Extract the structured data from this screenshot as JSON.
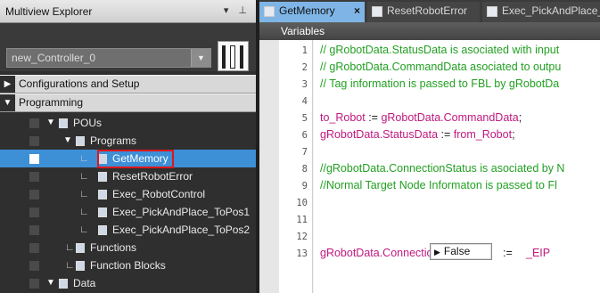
{
  "explorer": {
    "title": "Multiview Explorer",
    "pin_label": "▾ ᵖ",
    "controller": "new_Controller_0",
    "sections": {
      "configurations": "Configurations and Setup",
      "programming": "Programming"
    },
    "tree": {
      "pous": "POUs",
      "programs": "Programs",
      "items": [
        "GetMemory",
        "ResetRobotError",
        "Exec_RobotControl",
        "Exec_PickAndPlace_ToPos1",
        "Exec_PickAndPlace_ToPos2"
      ],
      "functions": "Functions",
      "function_blocks": "Function Blocks",
      "data": "Data"
    },
    "selected_item": "GetMemory",
    "highlight_color": "#e0161b",
    "selection_color": "#3d8fd6"
  },
  "tabs": [
    {
      "label": "GetMemory",
      "close": "×",
      "active": true
    },
    {
      "label": "ResetRobotError",
      "active": false
    },
    {
      "label": "Exec_PickAndPlace_",
      "active": false
    }
  ],
  "editor": {
    "variables_label": "Variables",
    "line_numbers": [
      "1",
      "2",
      "3",
      "4",
      "5",
      "6",
      "7",
      "8",
      "9",
      "10",
      "11",
      "12",
      "13"
    ],
    "lines": {
      "l1": "// gRobotData.StatusData is asociated with input",
      "l2": "// gRobotData.CommandData asociated to outpu",
      "l3": "// Tag information is passed to FBL by gRobotDa",
      "l5a": "to_Robot",
      "l5b": " := ",
      "l5c": "gRobotData.CommandData",
      "l5d": ";",
      "l6a": "gRobotData.StatusData",
      "l6b": " := ",
      "l6c": "from_Robot",
      "l6d": ";",
      "l8": "//gRobotData.ConnectionStatus is asociated by N",
      "l9": "//Normal Target Node Informaton is passed to Fl",
      "l12a": "gRobotData.ConnectionStatus",
      "l12b": ":=",
      "l12c": "_EIP"
    },
    "inline_value": "False",
    "inline_value_icon": "play-icon"
  }
}
